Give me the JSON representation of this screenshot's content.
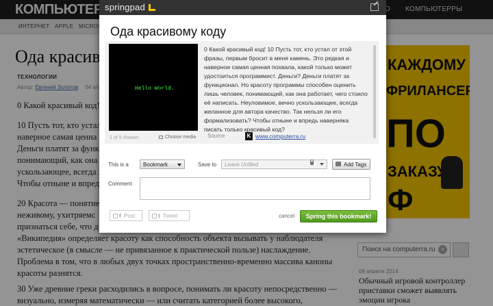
{
  "site": {
    "logo": "КОМПЬЮТЕР",
    "nav_right": [
      "О",
      "КОМПЬЮТЕРРЫ"
    ],
    "subnav": [
      "ИНТЕРНЕТ",
      "APPLE",
      "MICROS"
    ]
  },
  "article": {
    "title": "Ода красив",
    "category": "ТЕХНОЛОГИИ",
    "author_prefix": "Автор:",
    "author": "Евгений Золотов",
    "date": "04 апр",
    "paragraphs": [
      "0 Какой красивый код!",
      "10 Пусть тот, кто устал\nнаверное самая ценна\nДеньги платят за функ\nпонимающий, как она\nускользающее, всегда ж\nЧтобы отныне и впред",
      "20 Красота — понятие р\nнеживому, ухитряемс\nпризнаться себе, что д\n«Википедия» определяет красоту как способность объекта вызывать у наблюдателя\nэстетическое (в смысле — не привязанное к практической пользе) наслаждение.\nПроблема в том, что в любых двух точках пространственно-временно массива каноны\nкрасоты разнятся.",
      "30 Уже древние греки расходились в вопросе, понимать ли красоту непосредственно —\nвизуально, измеряя математически — или считать категорией более высокого,"
    ]
  },
  "sidebar": {
    "ad_lines": [
      "КАЖДОМУ",
      "ФРИЛАНСЕРУ",
      "ПО",
      "ЗАКАЗУ",
      "Ф"
    ],
    "search_placeholder": "Поиск на computerra.ru",
    "news_date": "08 апреля 2014",
    "news_title": "Обычный игровой контроллер\nприставки сможет выявлять\nэмоции игрока"
  },
  "modal": {
    "brand": "springpad",
    "title": "Ода красивому коду",
    "image_text": "Hello World.",
    "chosen_count": "1 of 5 chosen",
    "choose_media": "Choose media",
    "excerpt": "0 Какой красивый код! 10 Пусть тот, кто устал от этой фразы, первым бросит в меня камень. Это редкая и наверное самая ценная похвала, какой только может удостоиться программист. Деньги? Деньги платят за функционал. Но красоту программы способен оценить лишь человек, понимающий, как она работает, чего стоило её написать. Неуловимое, вечно ускользающее, всегда желанное для автора качество. Так нельзя ли его формализовать? Чтобы отныне и впредь наверняка писать только красивый код?",
    "source_label": "Source",
    "source_url": "www.computerra.ru",
    "this_is_label": "This is a",
    "type_value": "Bookmark",
    "save_to_label": "Save to",
    "save_to_value": "Leave Unfiled",
    "add_tags": "Add Tags",
    "comment_label": "Comment",
    "share_post": "Post",
    "share_tweet": "Tweet",
    "cancel": "cancel",
    "submit": "Spring this bookmark!"
  }
}
